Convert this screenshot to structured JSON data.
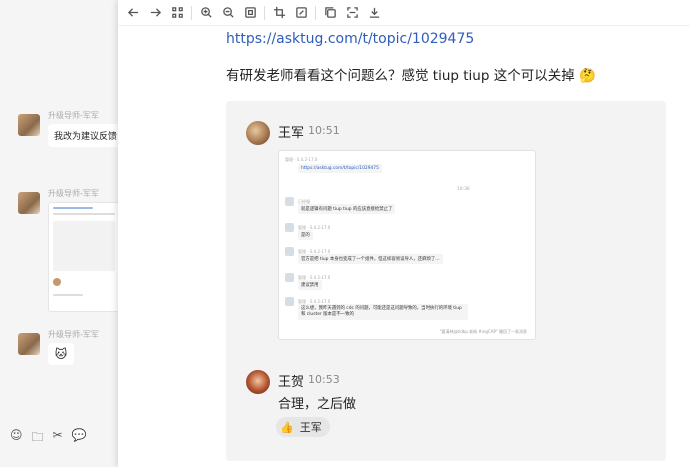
{
  "chat": {
    "messages": [
      {
        "sender": "升级导师-军军",
        "text": "我改为建议反馈"
      },
      {
        "sender": "升级导师-军军"
      },
      {
        "sender": "升级导师-军军",
        "emoji": "🐱"
      }
    ],
    "toolbar_icons": [
      "emoji-icon",
      "folder-icon",
      "scissors-icon",
      "chat-icon"
    ]
  },
  "viewer": {
    "toolbar_icons": [
      "back-icon",
      "forward-icon",
      "grid-icon",
      "zoom-in-icon",
      "zoom-out-icon",
      "fit-icon",
      "crop-icon",
      "edit-icon",
      "copy-icon",
      "scan-icon",
      "download-icon"
    ],
    "link": "https://asktug.com/t/topic/1029475",
    "question": "有研发老师看看这个问题么？感觉 tiup tiup 这个可以关掉 🤔",
    "card": {
      "user1": {
        "name": "王军",
        "time": "10:51"
      },
      "screenshot": {
        "rows": [
          {
            "name": "管理 · S.4.2-17.0",
            "text": "https://asktug.com/t/topic/1029475"
          },
          {
            "name": "已经服",
            "text": "就是逻辑有问题 tiup tiup 的应该直接给禁止了"
          },
          {
            "name": "管理 · S.4.2-17.0",
            "text": "是的"
          },
          {
            "name": "管理 · S.4.2-17.0",
            "text": "官方是把 tiup 本身也变成了一个组件，但这样容易误导人，还麻烦了…"
          },
          {
            "name": "管理 · S.4.2-17.0",
            "text": "建议禁用"
          },
          {
            "name": "管理 · S.4.2-17.0",
            "text": "这么想，我昨天遇到的 cdc 的问题，可能还是这问题导致的，当时执行的环境 tiup 和 cluster 版本是不一致的"
          }
        ],
        "time": "10:36",
        "footer": "\"要清林@tidbp.老街 #ingCAP\" 撤回了一条消息"
      },
      "user2": {
        "name": "王贺",
        "time": "10:53"
      },
      "reply": "合理，之后做",
      "reaction": {
        "emoji": "👍",
        "user": "王军"
      }
    }
  }
}
